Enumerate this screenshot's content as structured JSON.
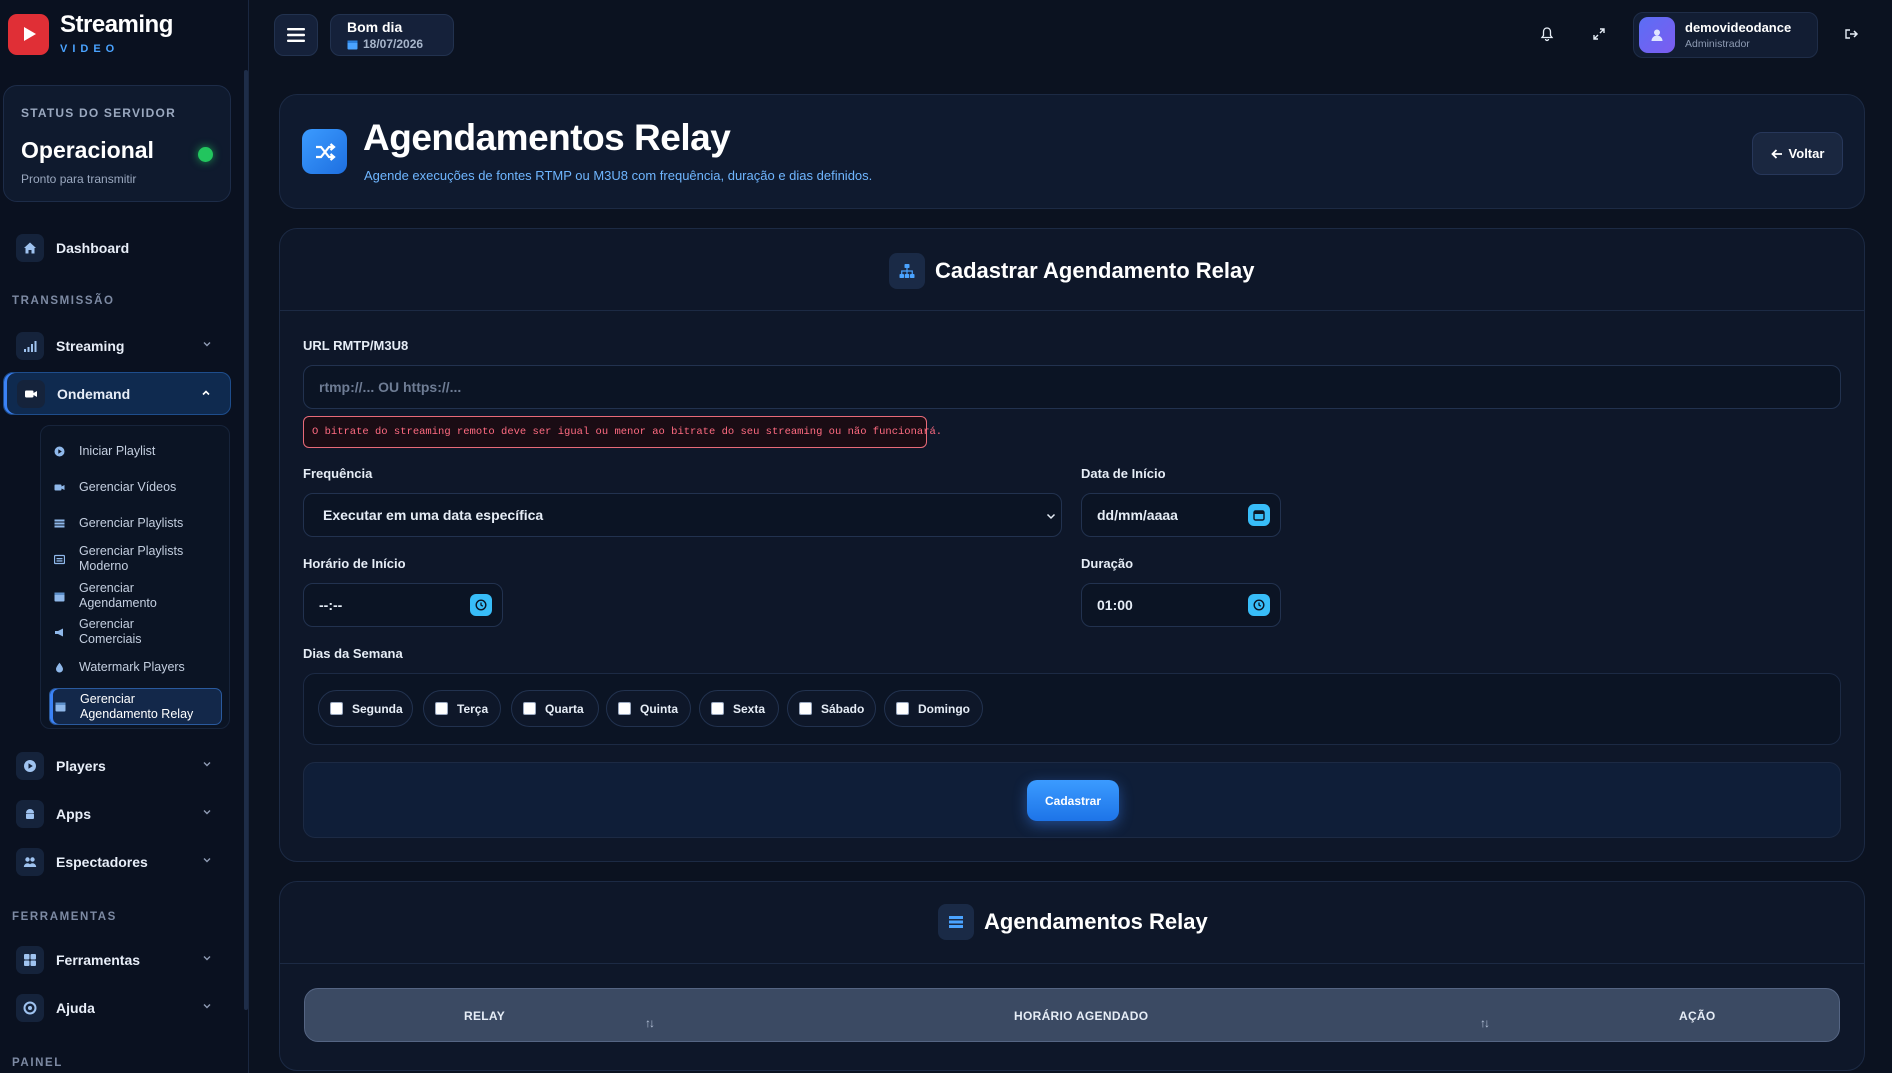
{
  "brand": {
    "name": "Streaming",
    "sub": "VIDEO"
  },
  "server_status": {
    "label": "STATUS DO SERVIDOR",
    "value": "Operacional",
    "sub": "Pronto para transmitir"
  },
  "sidebar": {
    "dashboard": "Dashboard",
    "section_transmissao": "TRANSMISSÃO",
    "streaming": "Streaming",
    "ondemand": "Ondemand",
    "submenu": [
      {
        "label": "Iniciar Playlist"
      },
      {
        "label": "Gerenciar Vídeos"
      },
      {
        "label": "Gerenciar Playlists"
      },
      {
        "label_line1": "Gerenciar Playlists",
        "label_line2": "Moderno"
      },
      {
        "label_line1": "Gerenciar",
        "label_line2": "Agendamento"
      },
      {
        "label_line1": "Gerenciar",
        "label_line2": "Comerciais"
      },
      {
        "label": "Watermark Players"
      },
      {
        "label_line1": "Gerenciar",
        "label_line2": "Agendamento Relay"
      }
    ],
    "players": "Players",
    "apps": "Apps",
    "espectadores": "Espectadores",
    "section_ferramentas": "FERRAMENTAS",
    "ferramentas": "Ferramentas",
    "ajuda": "Ajuda",
    "section_painel": "PAINEL"
  },
  "topbar": {
    "greeting": "Bom dia",
    "date": "18/07/2026",
    "user_name": "demovideodance",
    "user_role": "Administrador"
  },
  "header": {
    "title": "Agendamentos Relay",
    "subtitle": "Agende execuções de fontes RTMP ou M3U8 com frequência, duração e dias definidos.",
    "back_label": "Voltar"
  },
  "form": {
    "title": "Cadastrar Agendamento Relay",
    "url_label": "URL RMTP/M3U8",
    "url_placeholder": "rtmp://... OU https://...",
    "warning": "O bitrate do streaming remoto deve ser igual ou menor ao bitrate do seu streaming ou não funcionará.",
    "freq_label": "Frequência",
    "freq_value": "Executar em uma data específica",
    "date_label": "Data de Início",
    "date_value": "dd/mm/aaaa",
    "time_label": "Horário de Início",
    "time_value": "--:--",
    "duration_label": "Duração",
    "duration_value": "01:00",
    "days_label": "Dias da Semana",
    "days": [
      "Segunda",
      "Terça",
      "Quarta",
      "Quinta",
      "Sexta",
      "Sábado",
      "Domingo"
    ],
    "submit": "Cadastrar"
  },
  "list": {
    "title": "Agendamentos Relay",
    "columns": [
      "RELAY",
      "HORÁRIO AGENDADO",
      "AÇÃO"
    ],
    "sort_symbol": "↑↓"
  },
  "colors": {
    "accent": "#3b9bff",
    "success": "#22c55e",
    "danger": "#e02f36",
    "warning_text": "#ff6b81"
  }
}
